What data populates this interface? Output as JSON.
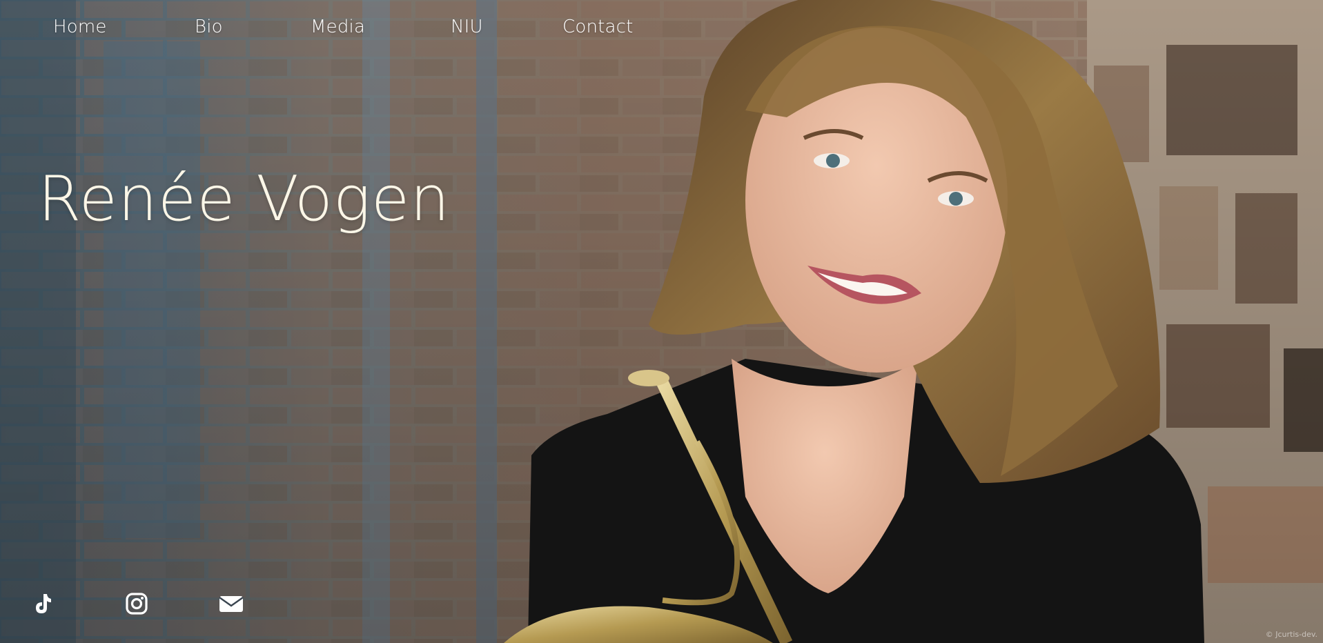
{
  "nav": {
    "items": [
      {
        "label": "Home"
      },
      {
        "label": "Bio"
      },
      {
        "label": "Media"
      },
      {
        "label": "NIU"
      },
      {
        "label": "Contact"
      }
    ]
  },
  "hero": {
    "title": "Renée Vogen"
  },
  "social": {
    "icons": [
      "tiktok-icon",
      "instagram-icon",
      "email-icon"
    ]
  },
  "footer": {
    "credit": "© Jcurtis-dev."
  },
  "colors": {
    "title": "#fbf6e7",
    "nav_text": "#ffffff",
    "icon": "#ffffff"
  }
}
